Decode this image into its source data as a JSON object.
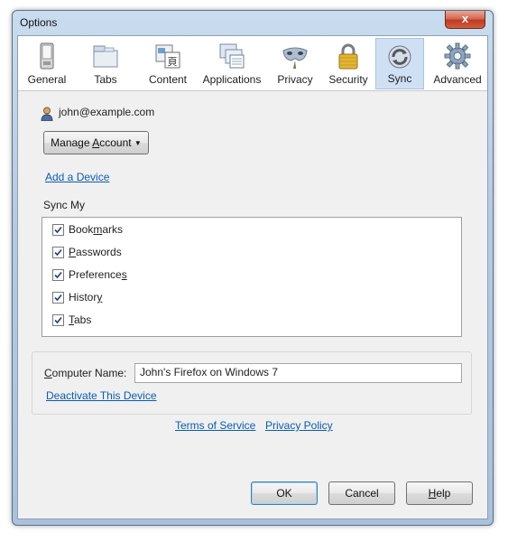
{
  "window": {
    "title": "Options",
    "close_glyph": "x"
  },
  "toolbar": {
    "panes": [
      {
        "label": "General",
        "icon": "general-icon"
      },
      {
        "label": "Tabs",
        "icon": "tabs-icon"
      },
      {
        "label": "Content",
        "icon": "content-icon"
      },
      {
        "label": "Applications",
        "icon": "applications-icon"
      },
      {
        "label": "Privacy",
        "icon": "privacy-mask-icon"
      },
      {
        "label": "Security",
        "icon": "padlock-icon"
      },
      {
        "label": "Sync",
        "icon": "sync-icon",
        "selected": true
      },
      {
        "label": "Advanced",
        "icon": "gear-icon"
      }
    ]
  },
  "sync": {
    "account_email": "john@example.com",
    "manage_account_pre": "Manage ",
    "manage_account_accel": "A",
    "manage_account_post": "ccount",
    "add_device_link": "Add a Device",
    "sync_my_label": "Sync My",
    "items": [
      {
        "pre": "Book",
        "accel": "m",
        "post": "arks",
        "checked": true
      },
      {
        "pre": "",
        "accel": "P",
        "post": "asswords",
        "checked": true
      },
      {
        "pre": "Preference",
        "accel": "s",
        "post": "",
        "checked": true
      },
      {
        "pre": "Histor",
        "accel": "y",
        "post": "",
        "checked": true
      },
      {
        "pre": "",
        "accel": "T",
        "post": "abs",
        "checked": true
      }
    ],
    "computer_name_pre": "",
    "computer_name_accel": "C",
    "computer_name_post": "omputer Name:",
    "computer_name_value": "John's Firefox on Windows 7",
    "deactivate_link": "Deactivate This Device",
    "terms_link": "Terms of Service",
    "privacy_link": "Privacy Policy"
  },
  "buttons": {
    "ok": "OK",
    "cancel": "Cancel",
    "help_accel": "H",
    "help_post": "elp"
  },
  "colors": {
    "link": "#0a5db6",
    "selected_pane": "#cfe0f4",
    "frame": "#b4cbe3"
  }
}
